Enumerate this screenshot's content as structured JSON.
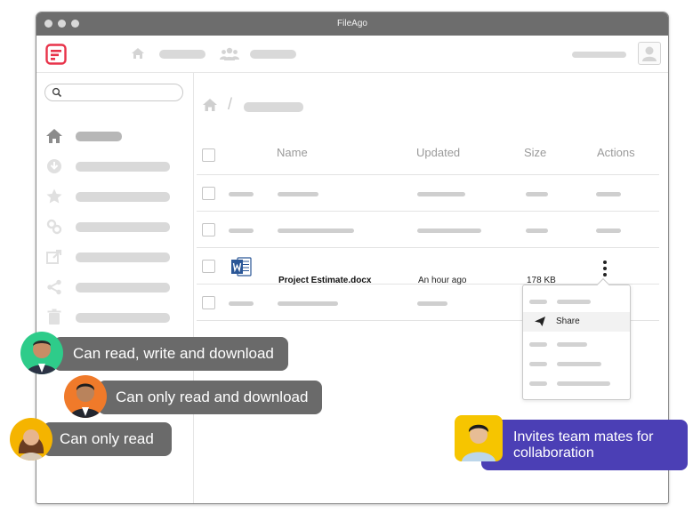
{
  "window": {
    "title": "FileAgo"
  },
  "brand": {
    "accent": "#e8334a"
  },
  "table": {
    "columns": [
      "Name",
      "Updated",
      "Size",
      "Actions"
    ],
    "file": {
      "name": "Project Estimate.docx",
      "updated": "An hour ago",
      "size": "178 KB",
      "icon": "word-doc-icon"
    }
  },
  "menu": {
    "share_label": "Share"
  },
  "permissions": [
    {
      "label": "Can read, write and download",
      "ring": "#2ecc8a"
    },
    {
      "label": "Can only read and download",
      "ring": "#f07a2a"
    },
    {
      "label": "Can only read",
      "ring": "#f5b400"
    }
  ],
  "invite": {
    "label": "Invites team mates for collaboration",
    "bg": "#4b3fb5"
  }
}
